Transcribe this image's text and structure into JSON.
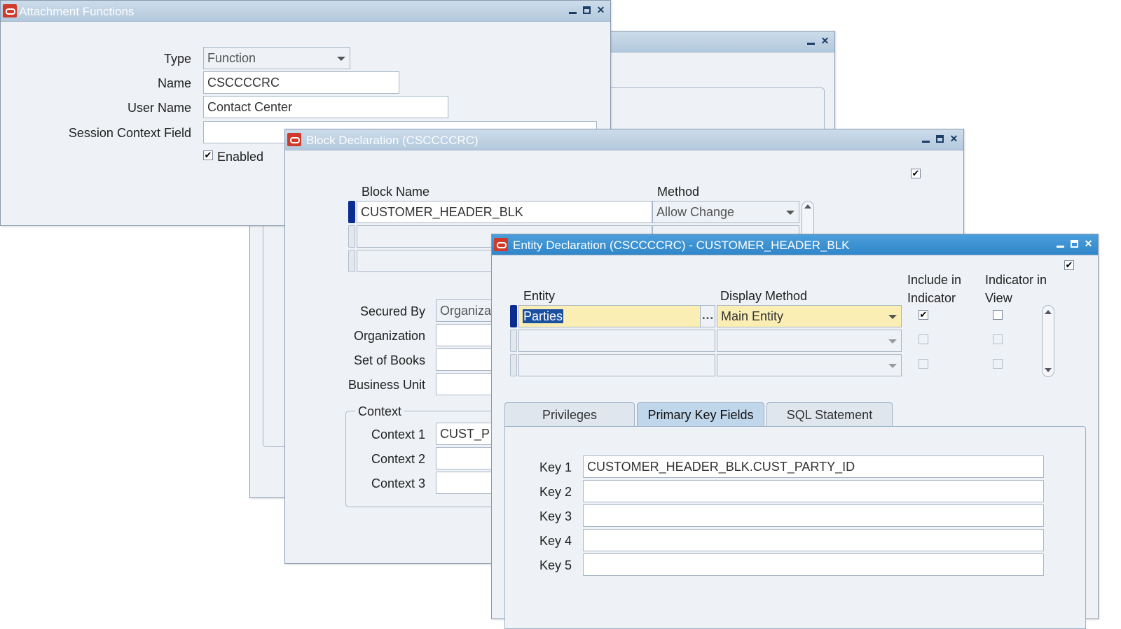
{
  "attachment_window": {
    "title": "Attachment Functions",
    "type_label": "Type",
    "type_value": "Function",
    "name_label": "Name",
    "name_value": "CSCCCCRC",
    "user_name_label": "User Name",
    "user_name_value": "Contact Center",
    "session_label": "Session Context Field",
    "session_value": "",
    "enabled_label": "Enabled",
    "enabled": true
  },
  "block_window": {
    "title": "Block Declaration (CSCCCCRC)",
    "block_name_header": "Block Name",
    "method_header": "Method",
    "rows": [
      {
        "block": "CUSTOMER_HEADER_BLK",
        "method": "Allow Change"
      },
      {
        "block": "",
        "method": ""
      },
      {
        "block": "",
        "method": ""
      }
    ],
    "secured_by_label": "Secured By",
    "secured_by_value": "Organiza",
    "organization_label": "Organization",
    "set_of_books_label": "Set of Books",
    "business_unit_label": "Business Unit",
    "context_group": "Context",
    "context1_label": "Context 1",
    "context1_value": "CUST_P",
    "context2_label": "Context 2",
    "context3_label": "Context 3"
  },
  "entity_window": {
    "title": "Entity Declaration (CSCCCCRC) - CUSTOMER_HEADER_BLK",
    "entity_header": "Entity",
    "display_method_header": "Display Method",
    "include_header": "Include in Indicator",
    "indicator_header": "Indicator in View",
    "rows": [
      {
        "entity": "Parties",
        "display": "Main Entity",
        "include": true,
        "indicator": false
      },
      {
        "entity": "",
        "display": "",
        "include": false,
        "indicator": false
      },
      {
        "entity": "",
        "display": "",
        "include": false,
        "indicator": false
      }
    ],
    "tabs": [
      "Privileges",
      "Primary Key Fields",
      "SQL Statement"
    ],
    "active_tab": "Primary Key Fields",
    "keys": [
      {
        "label": "Key 1",
        "value": "CUSTOMER_HEADER_BLK.CUST_PARTY_ID"
      },
      {
        "label": "Key 2",
        "value": ""
      },
      {
        "label": "Key 3",
        "value": ""
      },
      {
        "label": "Key 4",
        "value": ""
      },
      {
        "label": "Key 5",
        "value": ""
      }
    ]
  },
  "colors": {
    "active_title": "#2f86c9",
    "inactive_title": "#b3c9dd",
    "required_field": "#fbeeb5",
    "record_indicator": "#0a2d8f"
  }
}
